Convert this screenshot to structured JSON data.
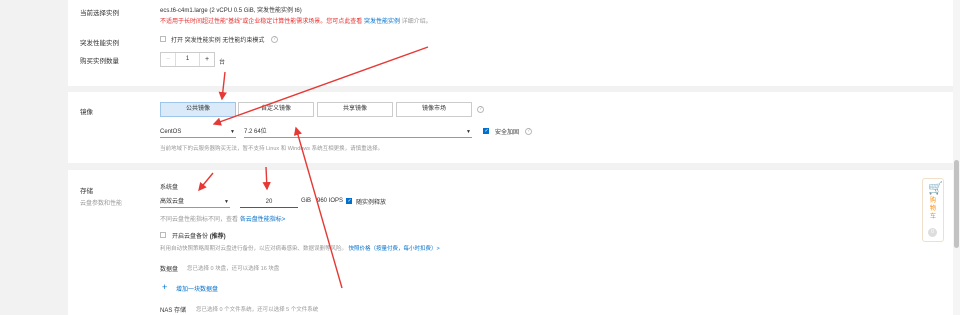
{
  "instance": {
    "label": "当前选择实例",
    "spec": "ecs.t6-c4m1.large (2 vCPU 0.5 GiB, 突发性能实例 t6)",
    "warning": "不适用于长时间超过性能\"基线\"或企业稳定计算性能需求场景。您可点此查看",
    "warning_link": "突发性能实例",
    "warning_tail": "详细介绍。"
  },
  "burst": {
    "label": "突发性能实例",
    "option": "打开 突发性能实例 无性能约束模式"
  },
  "quantity": {
    "label": "购买实例数量",
    "minus": "−",
    "value": "1",
    "plus": "+",
    "unit": "台"
  },
  "image": {
    "label": "镜像",
    "tabs": [
      "公共镜像",
      "自定义镜像",
      "共享镜像",
      "镜像市场"
    ],
    "os": "CentOS",
    "version": "7.2 64位",
    "security_label": "安全加固",
    "note": "当前地域下的云服务器购买无法，暂不支持 Linux 和 Windows 系统互相更换，请慎重选择。"
  },
  "storage": {
    "label": "存储",
    "sublabel": "云盘参数和性能",
    "system_disk": "系统盘",
    "disk_type": "高效云盘",
    "size": "20",
    "size_unit": "GiB",
    "iops": "960 IOPS",
    "release_label": "随实例释放",
    "perf_note": "不同云盘性能指标不同，查看",
    "perf_link": "各云盘性能指标>",
    "backup_label": "开启云盘备份",
    "backup_suffix": "(推荐)",
    "backup_note": "利用自动快照策略周期对云盘进行备份，以应对病毒感染、数据误删等风险。",
    "backup_link": "快照价格（按量付费，每小时扣费）>",
    "data_disk_label": "数据盘",
    "data_disk_note": "您已选择 0 块盘，还可以选择 16 块盘",
    "add_disk": "增加一块数据盘",
    "nas_label": "NAS 存储",
    "nas_note": "您已选择 0 个文件系统，还可以选择 5 个文件系统"
  },
  "sidebar": {
    "label": "购物车",
    "count": "0"
  },
  "colors": {
    "arrow": "#e53935",
    "accent": "#0070cc",
    "warning": "#e62e2e"
  }
}
